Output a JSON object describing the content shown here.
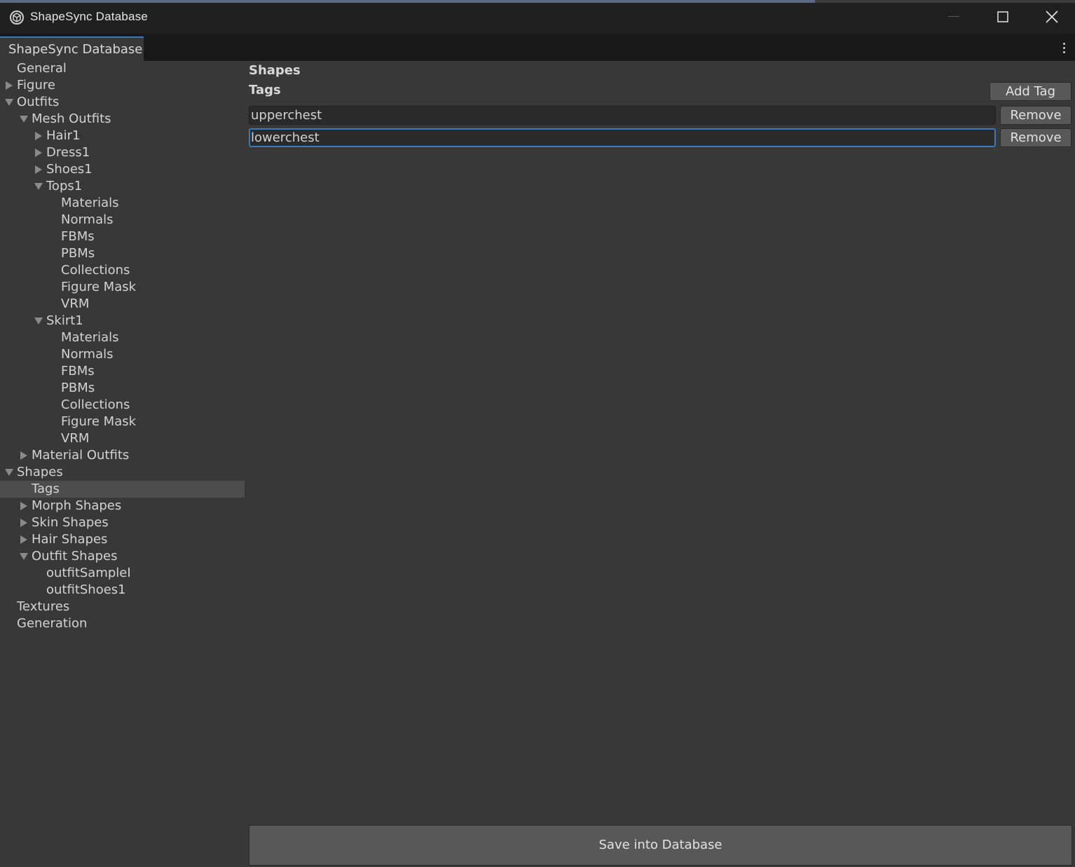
{
  "window": {
    "title": "ShapeSync Database",
    "tab_label": "ShapeSync Database"
  },
  "tree": [
    {
      "label": "General",
      "depth": 0,
      "arrow": "none"
    },
    {
      "label": "Figure",
      "depth": 0,
      "arrow": "collapsed"
    },
    {
      "label": "Outfits",
      "depth": 0,
      "arrow": "expanded"
    },
    {
      "label": "Mesh Outfits",
      "depth": 1,
      "arrow": "expanded"
    },
    {
      "label": "Hair1",
      "depth": 2,
      "arrow": "collapsed"
    },
    {
      "label": "Dress1",
      "depth": 2,
      "arrow": "collapsed"
    },
    {
      "label": "Shoes1",
      "depth": 2,
      "arrow": "collapsed"
    },
    {
      "label": "Tops1",
      "depth": 2,
      "arrow": "expanded"
    },
    {
      "label": "Materials",
      "depth": 3,
      "arrow": "none"
    },
    {
      "label": "Normals",
      "depth": 3,
      "arrow": "none"
    },
    {
      "label": "FBMs",
      "depth": 3,
      "arrow": "none"
    },
    {
      "label": "PBMs",
      "depth": 3,
      "arrow": "none"
    },
    {
      "label": "Collections",
      "depth": 3,
      "arrow": "none"
    },
    {
      "label": "Figure Mask",
      "depth": 3,
      "arrow": "none"
    },
    {
      "label": "VRM",
      "depth": 3,
      "arrow": "none"
    },
    {
      "label": "Skirt1",
      "depth": 2,
      "arrow": "expanded"
    },
    {
      "label": "Materials",
      "depth": 3,
      "arrow": "none"
    },
    {
      "label": "Normals",
      "depth": 3,
      "arrow": "none"
    },
    {
      "label": "FBMs",
      "depth": 3,
      "arrow": "none"
    },
    {
      "label": "PBMs",
      "depth": 3,
      "arrow": "none"
    },
    {
      "label": "Collections",
      "depth": 3,
      "arrow": "none"
    },
    {
      "label": "Figure Mask",
      "depth": 3,
      "arrow": "none"
    },
    {
      "label": "VRM",
      "depth": 3,
      "arrow": "none"
    },
    {
      "label": "Material Outfits",
      "depth": 1,
      "arrow": "collapsed"
    },
    {
      "label": "Shapes",
      "depth": 0,
      "arrow": "expanded"
    },
    {
      "label": "Tags",
      "depth": 1,
      "arrow": "none",
      "selected": true
    },
    {
      "label": "Morph Shapes",
      "depth": 1,
      "arrow": "collapsed"
    },
    {
      "label": "Skin Shapes",
      "depth": 1,
      "arrow": "collapsed"
    },
    {
      "label": "Hair Shapes",
      "depth": 1,
      "arrow": "collapsed"
    },
    {
      "label": "Outfit Shapes",
      "depth": 1,
      "arrow": "expanded"
    },
    {
      "label": "outfitSampleI",
      "depth": 2,
      "arrow": "none"
    },
    {
      "label": "outfitShoes1",
      "depth": 2,
      "arrow": "none"
    },
    {
      "label": "Textures",
      "depth": 0,
      "arrow": "none"
    },
    {
      "label": "Generation",
      "depth": 0,
      "arrow": "none"
    }
  ],
  "panel": {
    "section_title": "Shapes",
    "subsection_title": "Tags",
    "add_tag_label": "Add Tag",
    "tags": [
      {
        "value": "upperchest",
        "remove_label": "Remove",
        "focused": false
      },
      {
        "value": "lowerchest",
        "remove_label": "Remove",
        "focused": true
      }
    ],
    "save_label": "Save into Database"
  },
  "colors": {
    "accent": "#3a79bb",
    "background": "#383838",
    "titlebar": "#202020"
  }
}
